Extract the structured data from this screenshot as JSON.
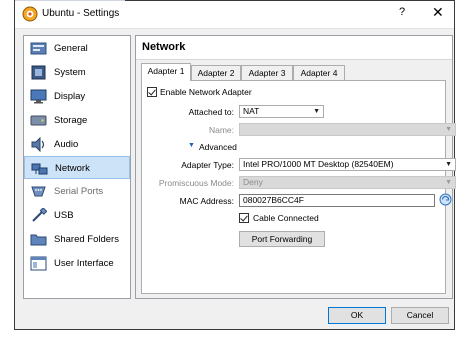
{
  "window": {
    "title": "Ubuntu - Settings",
    "help_glyph": "?",
    "close_glyph": "✕"
  },
  "sidebar": {
    "items": [
      {
        "label": "General",
        "icon": "general-icon"
      },
      {
        "label": "System",
        "icon": "system-icon"
      },
      {
        "label": "Display",
        "icon": "display-icon"
      },
      {
        "label": "Storage",
        "icon": "storage-icon"
      },
      {
        "label": "Audio",
        "icon": "audio-icon"
      },
      {
        "label": "Network",
        "icon": "network-icon",
        "selected": true
      },
      {
        "label": "Serial Ports",
        "icon": "serial-ports-icon"
      },
      {
        "label": "USB",
        "icon": "usb-icon"
      },
      {
        "label": "Shared Folders",
        "icon": "shared-folders-icon"
      },
      {
        "label": "User Interface",
        "icon": "user-interface-icon"
      }
    ]
  },
  "panel": {
    "title": "Network",
    "tabs": [
      "Adapter 1",
      "Adapter 2",
      "Adapter 3",
      "Adapter 4"
    ],
    "enable_label": "Enable Network Adapter",
    "attached_label": "Attached to:",
    "attached_value": "NAT",
    "name_label": "Name:",
    "advanced_label": "Advanced",
    "adapter_type_label": "Adapter Type:",
    "adapter_type_value": "Intel PRO/1000 MT Desktop (82540EM)",
    "promiscuous_label": "Promiscuous Mode:",
    "promiscuous_value": "Deny",
    "mac_label": "MAC Address:",
    "mac_value": "080027B6CC4F",
    "cable_label": "Cable Connected",
    "port_forwarding_label": "Port Forwarding"
  },
  "footer": {
    "ok_label": "OK",
    "cancel_label": "Cancel"
  },
  "colors": {
    "selected_bg": "#cde3f7",
    "accent": "#0078d7"
  }
}
